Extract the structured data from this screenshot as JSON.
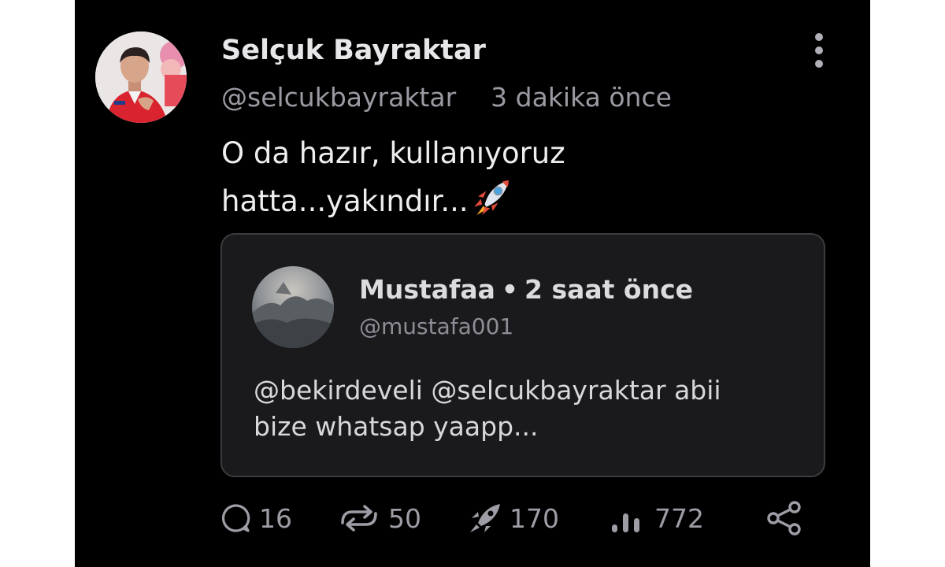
{
  "post": {
    "author": {
      "name": "Selçuk Bayraktar",
      "handle": "@selcukbayraktar",
      "avatar_icon": "profile-photo"
    },
    "time": "3 dakika önce",
    "text_lines": [
      "O da hazır, kullanıyoruz",
      "hatta...yakındır..."
    ],
    "emoji": "rocket-emoji",
    "more_icon": "vertical-dots-icon"
  },
  "quote": {
    "author": "Mustafaa",
    "separator": "•",
    "time": "2 saat önce",
    "handle": "@mustafa001",
    "text_lines": [
      "@bekirdeveli @selcukbayraktar  abii",
      "bize whatsap yaapp..."
    ]
  },
  "actions": {
    "replies": {
      "count": "16",
      "icon": "comment-icon"
    },
    "reposts": {
      "count": "50",
      "icon": "repost-icon"
    },
    "boosts": {
      "count": "170",
      "icon": "rocket-icon"
    },
    "views": {
      "count": "772",
      "icon": "views-bar-icon"
    },
    "share": {
      "icon": "share-icon"
    }
  },
  "colors": {
    "background": "#000000",
    "card": "#1a1a1c",
    "primary_text": "#e7e7ea",
    "secondary_text": "#9b9aa3"
  }
}
